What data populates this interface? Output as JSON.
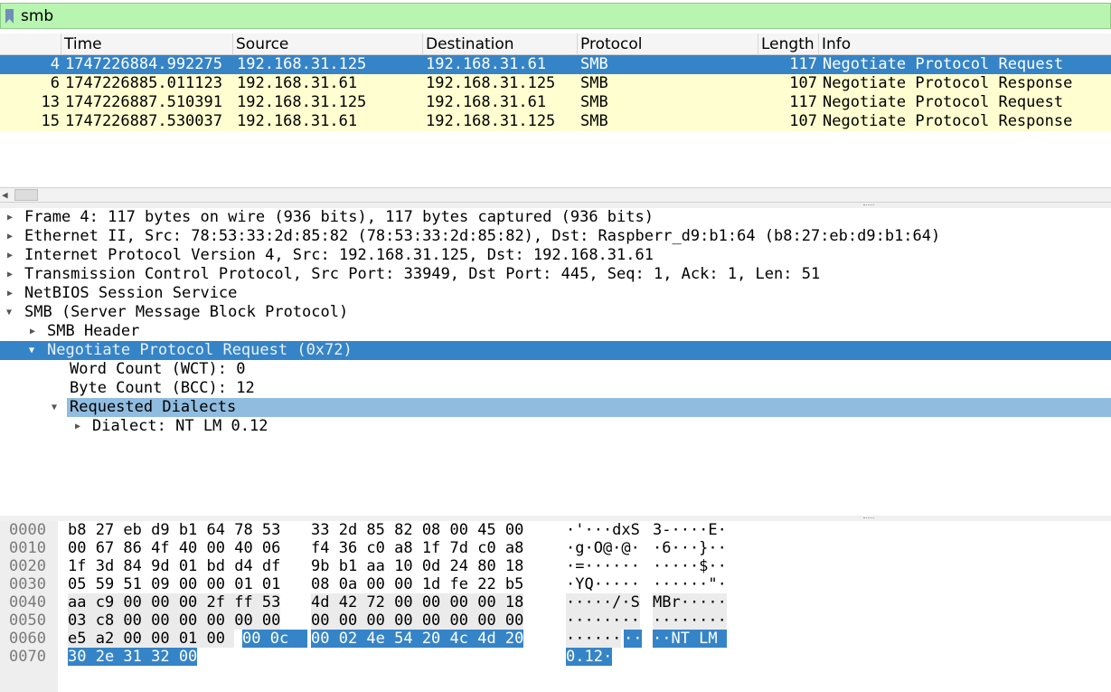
{
  "filter": {
    "value": "smb"
  },
  "packet_list": {
    "columns": [
      "Time",
      "Source",
      "Destination",
      "Protocol",
      "Length",
      "Info"
    ],
    "rows": [
      {
        "no": "4",
        "time": "1747226884.992275",
        "source": "192.168.31.125",
        "destination": "192.168.31.61",
        "protocol": "SMB",
        "length": "117",
        "info": "Negotiate Protocol Request"
      },
      {
        "no": "6",
        "time": "1747226885.011123",
        "source": "192.168.31.61",
        "destination": "192.168.31.125",
        "protocol": "SMB",
        "length": "107",
        "info": "Negotiate Protocol Response"
      },
      {
        "no": "13",
        "time": "1747226887.510391",
        "source": "192.168.31.125",
        "destination": "192.168.31.61",
        "protocol": "SMB",
        "length": "117",
        "info": "Negotiate Protocol Request"
      },
      {
        "no": "15",
        "time": "1747226887.530037",
        "source": "192.168.31.61",
        "destination": "192.168.31.125",
        "protocol": "SMB",
        "length": "107",
        "info": "Negotiate Protocol Response"
      }
    ]
  },
  "details": [
    "Frame 4: 117 bytes on wire (936 bits), 117 bytes captured (936 bits)",
    "Ethernet II, Src: 78:53:33:2d:85:82 (78:53:33:2d:85:82), Dst: Raspberr_d9:b1:64 (b8:27:eb:d9:b1:64)",
    "Internet Protocol Version 4, Src: 192.168.31.125, Dst: 192.168.31.61",
    "Transmission Control Protocol, Src Port: 33949, Dst Port: 445, Seq: 1, Ack: 1, Len: 51",
    "NetBIOS Session Service",
    "SMB (Server Message Block Protocol)",
    "SMB Header",
    "Negotiate Protocol Request (0x72)",
    "Word Count (WCT): 0",
    "Byte Count (BCC): 12",
    "Requested Dialects",
    "Dialect: NT LM 0.12"
  ],
  "bytes": {
    "offsets": [
      "0000",
      "0010",
      "0020",
      "0030",
      "0040",
      "0050",
      "0060",
      "0070"
    ],
    "hex": [
      [
        "b8 27 eb d9 b1 64 78 53",
        "33 2d 85 82 08 00 45 00"
      ],
      [
        "00 67 86 4f 40 00 40 06",
        "f4 36 c0 a8 1f 7d c0 a8"
      ],
      [
        "1f 3d 84 9d 01 bd d4 df",
        "9b b1 aa 10 0d 24 80 18"
      ],
      [
        "05 59 51 09 00 00 01 01",
        "08 0a 00 00 1d fe 22 b5"
      ],
      [
        "aa c9 00 00 00 2f ff 53",
        "4d 42 72 00 00 00 00 18"
      ],
      [
        "03 c8 00 00 00 00 00 00",
        "00 00 00 00 00 00 00 00"
      ],
      [
        "e5 a2 00 00 01 00 ",
        "00 0c",
        "00 02 4e 54 20 4c 4d 20"
      ],
      [
        "30 2e 31 32 00"
      ]
    ],
    "ascii": [
      [
        "·'···dxS",
        "3-····E·"
      ],
      [
        "·g·O@·@·",
        "·6···}··"
      ],
      [
        "·=······",
        "·····$··"
      ],
      [
        "·YQ·····",
        "······\"·"
      ],
      [
        "·····/·S",
        "MBr·····"
      ],
      [
        "········",
        "········"
      ],
      [
        "······",
        "··",
        "··NT LM "
      ],
      [
        "0.12·"
      ]
    ]
  },
  "colors": {
    "filter_ok": "#b7f5b0",
    "selection": "#3584c7",
    "smb_row": "#fefed1",
    "field_highlight": "#90bce0"
  }
}
